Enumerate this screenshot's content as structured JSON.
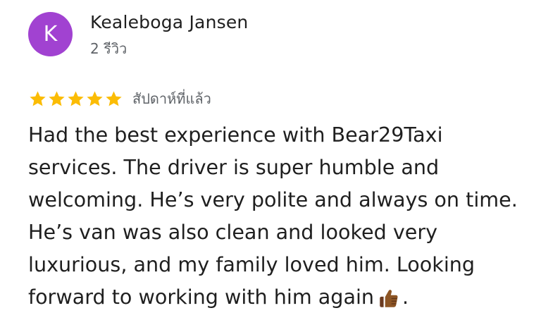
{
  "review": {
    "author": {
      "initial": "K",
      "name": "Kealeboga Jansen",
      "meta": "2 รีวิว",
      "avatar_color": "#a142d1"
    },
    "rating": {
      "stars": 5,
      "max": 5,
      "star_color": "#fbbc04",
      "time_ago": "สัปดาห์ที่แล้ว"
    },
    "text_before_emoji": "Had the best experience with Bear29Taxi\nservices. The driver is super humble and\nwelcoming. He’s very polite and always on time.\nHe’s van was also clean and looked very\nluxurious,  and my family loved him. Looking\nforward to working with him again",
    "emoji": "thumbs-up-icon",
    "text_after_emoji": "."
  }
}
